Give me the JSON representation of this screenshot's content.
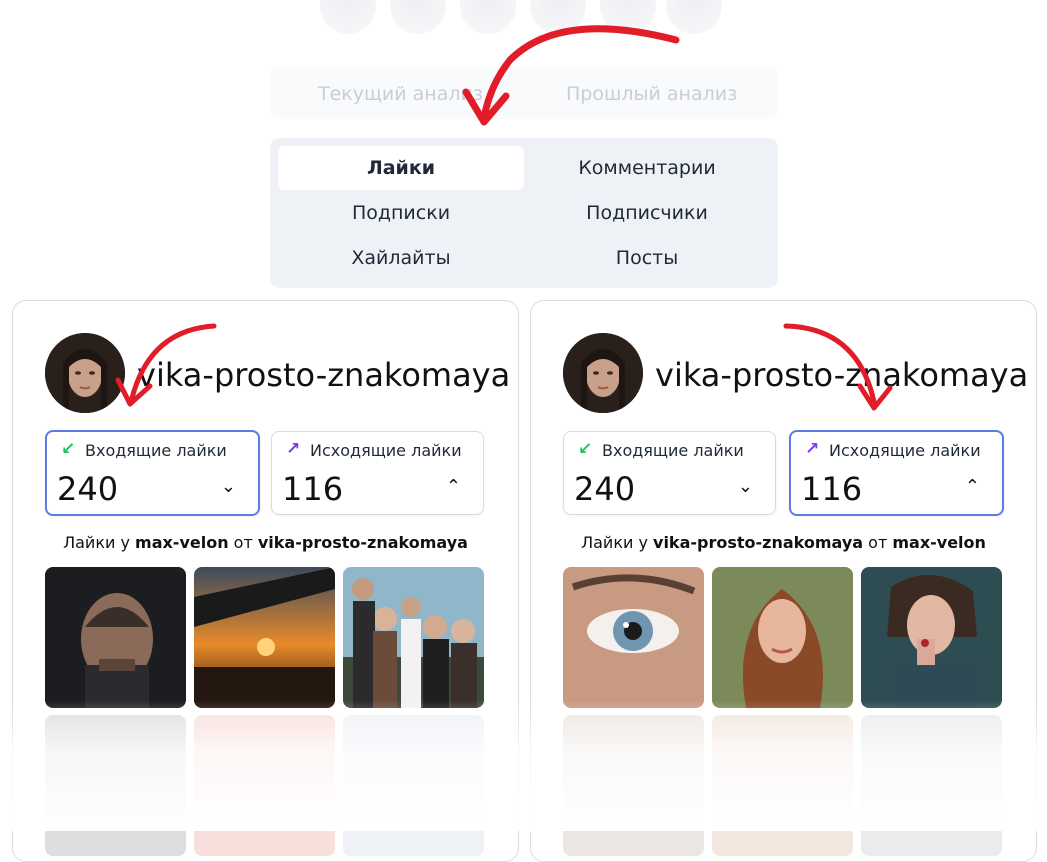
{
  "analysis_tabs": {
    "current": "Текущий анализ",
    "past": "Прошлый анализ"
  },
  "categories": [
    {
      "label": "Лайки",
      "active": true
    },
    {
      "label": "Комментарии",
      "active": false
    },
    {
      "label": "Подписки",
      "active": false
    },
    {
      "label": "Подписчики",
      "active": false
    },
    {
      "label": "Хайлайты",
      "active": false
    },
    {
      "label": "Посты",
      "active": false
    }
  ],
  "cards": [
    {
      "username": "vika-prosto-znakomaya",
      "incoming": {
        "label": "Входящие лайки",
        "value": "240",
        "chevron": "⌄"
      },
      "outgoing": {
        "label": "Исходящие лайки",
        "value": "116",
        "chevron": "⌃"
      },
      "caption": {
        "prefix": "Лайки у ",
        "subject": "max-velon",
        "middle": " от ",
        "object": "vika-prosto-znakomaya"
      }
    },
    {
      "username": "vika-prosto-znakomaya",
      "incoming": {
        "label": "Входящие лайки",
        "value": "240",
        "chevron": "⌄"
      },
      "outgoing": {
        "label": "Исходящие лайки",
        "value": "116",
        "chevron": "⌃"
      },
      "caption": {
        "prefix": "Лайки у ",
        "subject": "vika-prosto-znakomaya",
        "middle": " от ",
        "object": "max-velon"
      }
    }
  ],
  "colors": {
    "accent": "#5b7be6",
    "incoming_arrow": "#22c55e",
    "outgoing_arrow": "#7c3aed",
    "annotation": "#e11d2a"
  }
}
